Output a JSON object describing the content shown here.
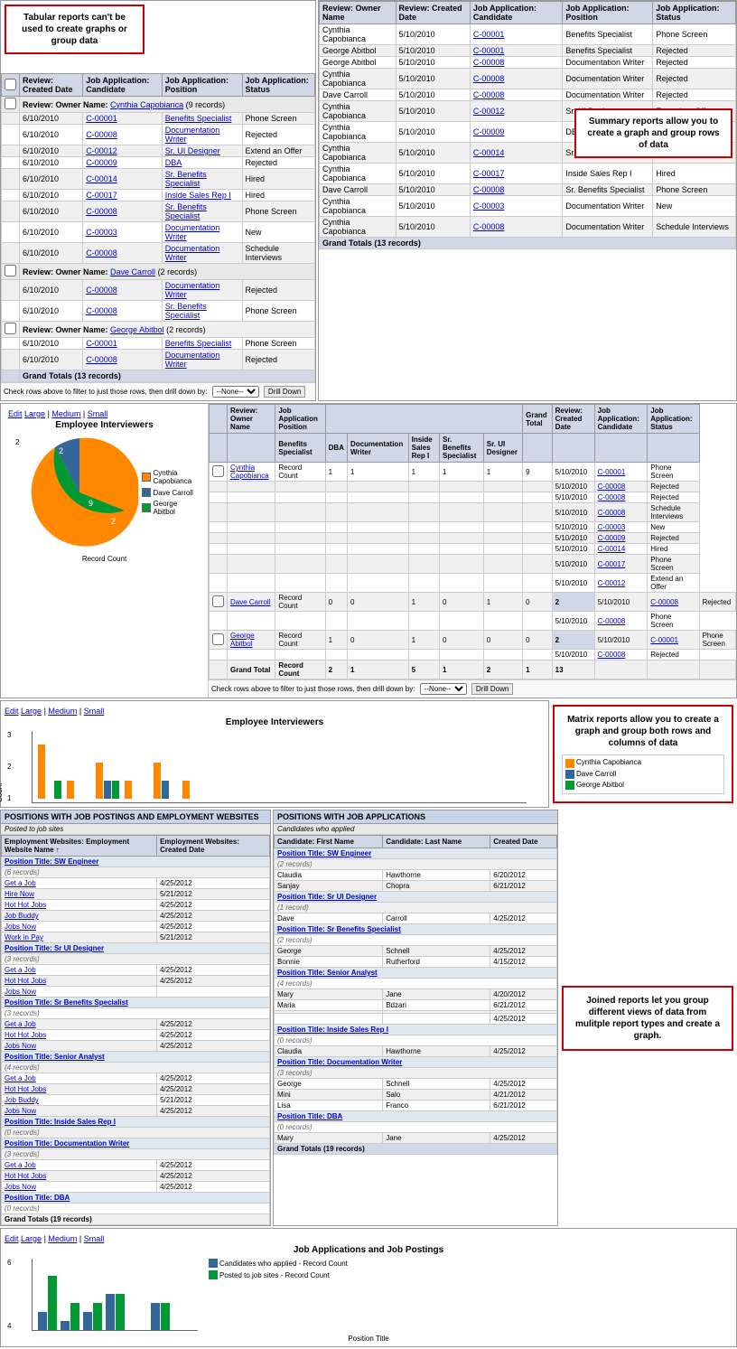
{
  "callouts": {
    "tabular": "Tabular reports can't be used to create graphs or group data",
    "summary": "Summary reports allow you to create a graph and group rows of data",
    "matrix": "Matrix reports allow you to create a graph and group both rows and columns of data",
    "joined": "Joined reports let you group different views of data from mulitple report types and create a graph."
  },
  "tabular_report": {
    "headers": [
      "Review: Created Date",
      "Job Application: Candidate",
      "Job Application: Position",
      "Job Application: Status"
    ],
    "group_label": "Review: Owner Name",
    "groups": [
      {
        "name": "Cynthia Capobianca",
        "count": "9 records",
        "rows": [
          [
            "6/10/2010",
            "C-00001",
            "Benefits Specialist",
            "Phone Screen"
          ],
          [
            "6/10/2010",
            "C-00008",
            "Documentation Writer",
            "Rejected"
          ],
          [
            "6/10/2010",
            "C-00012",
            "Sr. UI Designer",
            "Extend an Offer"
          ],
          [
            "6/10/2010",
            "C-00009",
            "DBA",
            "Rejected"
          ],
          [
            "6/10/2010",
            "C-00014",
            "Sr. Benefits Specialist",
            "Hired"
          ],
          [
            "6/10/2010",
            "C-00017",
            "Inside Sales Rep I",
            "Hired"
          ],
          [
            "6/10/2010",
            "C-00008",
            "Sr. Benefits Specialist",
            "Phone Screen"
          ],
          [
            "6/10/2010",
            "C-00003",
            "Documentation Writer",
            "New"
          ],
          [
            "6/10/2010",
            "C-00008",
            "Documentation Writer",
            "Schedule Interviews"
          ]
        ]
      },
      {
        "name": "Dave Carroll",
        "count": "2 records",
        "rows": [
          [
            "6/10/2010",
            "C-00008",
            "Documentation Writer",
            "Rejected"
          ],
          [
            "6/10/2010",
            "C-00008",
            "Sr. Benefits Specialist",
            "Phone Screen"
          ]
        ]
      },
      {
        "name": "George Abitbol",
        "count": "2 records",
        "rows": [
          [
            "6/10/2010",
            "C-00001",
            "Benefits Specialist",
            "Phone Screen"
          ],
          [
            "6/10/2010",
            "C-00008",
            "Documentation Writer",
            "Rejected"
          ]
        ]
      }
    ],
    "grand_total": "Grand Totals (13 records)"
  },
  "summary_report": {
    "headers": [
      "Review: Owner Name",
      "Review: Created Date",
      "Job Application: Candidate",
      "Job Application: Position",
      "Job Application: Status"
    ],
    "rows": [
      [
        "Cynthia Capobianca",
        "5/10/2010",
        "C-00001",
        "Benefits Specialist",
        "Phone Screen"
      ],
      [
        "George Abitbol",
        "5/10/2010",
        "C-00001",
        "Benefits Specialist",
        "Rejected"
      ],
      [
        "George Abitbol",
        "5/10/2010",
        "C-00008",
        "Documentation Writer",
        "Rejected"
      ],
      [
        "Cynthia Capobianca",
        "5/10/2010",
        "C-00008",
        "Documentation Writer",
        "Rejected"
      ],
      [
        "Dave Carroll",
        "5/10/2010",
        "C-00008",
        "Documentation Writer",
        "Rejected"
      ],
      [
        "Cynthia Capobianca",
        "5/10/2010",
        "C-00012",
        "Sr. UI Designer",
        "Extend an Offer"
      ],
      [
        "Cynthia Capobianca",
        "5/10/2010",
        "C-00009",
        "DBA",
        "Rejected"
      ],
      [
        "Cynthia Capobianca",
        "5/10/2010",
        "C-00014",
        "Sr. Benefits Specialist",
        "Hired"
      ],
      [
        "Cynthia Capobianca",
        "5/10/2010",
        "C-00017",
        "Inside Sales Rep I",
        "Hired"
      ],
      [
        "Dave Carroll",
        "5/10/2010",
        "C-00008",
        "Sr. Benefits Specialist",
        "Phone Screen"
      ],
      [
        "Cynthia Capobianca",
        "5/10/2010",
        "C-00003",
        "Documentation Writer",
        "New"
      ],
      [
        "Cynthia Capobianca",
        "5/10/2010",
        "C-00008",
        "Documentation Writer",
        "Schedule Interviews"
      ],
      [
        "Cynthia Capobianca",
        "5/10/2010",
        "C-00008",
        "Documentation Writer",
        "Schedule Interviews"
      ]
    ],
    "grand_total": "Grand Totals (13 records)"
  },
  "drill_controls": {
    "label": "Check rows above to filter to just those rows, then drill down by:",
    "placeholder": "--None--",
    "button": "Drill Down"
  },
  "pie_chart": {
    "title": "Employee Interviewers",
    "y_label": "Record Count",
    "legend": [
      {
        "label": "Cynthia Capobianca",
        "color": "#ff8800"
      },
      {
        "label": "Dave Carroll",
        "color": "#336699"
      },
      {
        "label": "George Abitbol",
        "color": "#ff6600"
      }
    ],
    "values": [
      {
        "name": "Cynthia",
        "value": 9,
        "color": "#ff8800"
      },
      {
        "name": "Dave",
        "value": 2,
        "color": "#336699"
      },
      {
        "name": "George",
        "value": 2,
        "color": "#009933"
      }
    ],
    "y_ticks": [
      "2",
      ""
    ],
    "x_label": "Record Count"
  },
  "matrix_report": {
    "title": "Employee Interviewers",
    "bar_colors": {
      "cynthia": "#ff8800",
      "dave": "#336699",
      "george": "#009933"
    },
    "y_ticks": [
      "3",
      "2",
      "1"
    ],
    "y_label": "Record Count",
    "legend": [
      {
        "label": "Cynthia Capobianca",
        "color": "#ff8800"
      },
      {
        "label": "Dave Carroll",
        "color": "#336699"
      },
      {
        "label": "George Abitbol",
        "color": "#009933"
      }
    ]
  },
  "joined_left": {
    "title": "POSITIONS WITH JOB POSTINGS AND EMPLOYMENT WEBSITES",
    "subtitle": "Posted to job sites",
    "headers": [
      "Employment Websites: Employment Website Name",
      "Employment Websites: Created Date"
    ],
    "positions": [
      {
        "title": "SW Engineer",
        "count": "6 records",
        "rows": [
          [
            "Get a Job",
            "4/25/2012"
          ],
          [
            "Hire Now",
            "5/21/2012"
          ],
          [
            "Hot Hot Jobs",
            "4/25/2012"
          ],
          [
            "Job Buddy",
            "4/25/2012"
          ],
          [
            "Jobs Now",
            "4/25/2012"
          ],
          [
            "Work in Pay",
            "5/21/2012"
          ]
        ]
      },
      {
        "title": "Sr UI Designer",
        "count": "3 records",
        "rows": [
          [
            "Get a Job",
            "4/25/2012"
          ],
          [
            "Hot Hot Jobs",
            "4/25/2012"
          ],
          [
            "Jobs Now",
            ""
          ]
        ]
      },
      {
        "title": "Sr Benefits Specialist",
        "count": "3 records",
        "rows": [
          [
            "Get a Job",
            "4/25/2012"
          ],
          [
            "Hot Hot Jobs",
            "4/25/2012"
          ],
          [
            "Jobs Now",
            "4/25/2012"
          ]
        ]
      },
      {
        "title": "Senior Analyst",
        "count": "4 records",
        "rows": [
          [
            "Get a Job",
            "4/25/2012"
          ],
          [
            "Hot Hot Jobs",
            "4/25/2012"
          ],
          [
            "Job Buddy",
            "5/21/2012"
          ],
          [
            "Jobs Now",
            "4/25/2012"
          ]
        ]
      },
      {
        "title": "Inside Sales Rep I",
        "count": "0 records",
        "rows": []
      },
      {
        "title": "Documentation Writer",
        "count": "3 records",
        "rows": [
          [
            "Get a Job",
            "4/25/2012"
          ],
          [
            "Hot Hot Jobs",
            "4/25/2012"
          ],
          [
            "Jobs Now",
            "4/25/2012"
          ]
        ]
      },
      {
        "title": "DBA",
        "count": "0 records",
        "rows": []
      }
    ],
    "grand_total": "Grand Totals (19 records)"
  },
  "joined_right": {
    "title": "POSITIONS WITH JOB APPLICATIONS",
    "subtitle": "Candidates who applied",
    "headers": [
      "Candidate: First Name",
      "Candidate: Last Name",
      "Created Date"
    ],
    "positions": [
      {
        "title": "SW Engineer",
        "count": "2 records",
        "rows": [
          [
            "Claudia",
            "Hawthorne",
            "6/20/2012"
          ],
          [
            "Sanjay",
            "Chopra",
            "6/21/2012"
          ]
        ]
      },
      {
        "title": "Sr UI Designer",
        "count": "1 record",
        "rows": [
          [
            "Dave",
            "Carroll",
            "4/25/2012"
          ]
        ]
      },
      {
        "title": "Sr Benefits Specialist",
        "count": "2 records",
        "rows": [
          [
            "George",
            "Schnell",
            "4/25/2012"
          ],
          [
            "Bonnie",
            "Rutherford",
            "4/15/2012"
          ]
        ]
      },
      {
        "title": "Senior Analyst",
        "count": "4 records",
        "rows": [
          [
            "Mary",
            "Jane",
            "4/20/2012"
          ],
          [
            "Maria",
            "Bdzari",
            "6/21/2012"
          ],
          [
            "",
            "",
            ""
          ],
          [
            "",
            "",
            "4/25/2012"
          ]
        ]
      },
      {
        "title": "Inside Sales Rep I",
        "count": "0 records",
        "rows": [
          [
            "Claudia",
            "Hawthorne",
            "4/25/2012"
          ]
        ]
      },
      {
        "title": "Documentation Writer",
        "count": "3 records",
        "rows": [
          [
            "George",
            "Schnell",
            "4/25/2012"
          ],
          [
            "Mini",
            "Salo",
            "4/21/2012"
          ],
          [
            "Lisa",
            "Franco",
            "6/21/2012"
          ]
        ]
      },
      {
        "title": "DBA",
        "count": "0 records",
        "rows": [
          [
            "Mary",
            "Jane",
            "4/25/2012"
          ]
        ]
      }
    ],
    "grand_total": "Grand Totals (19 records)"
  },
  "bottom_chart": {
    "title": "Job Applications and Job Postings",
    "edit_label": "Edit",
    "large_label": "Large",
    "medium_label": "Medium",
    "small_label": "Small",
    "y_ticks": [
      "6",
      "4"
    ],
    "legend": [
      {
        "label": "Candidates who applied - Record Count",
        "color": "#336699"
      },
      {
        "label": "Posted to job sites - Record Count",
        "color": "#009933"
      }
    ],
    "x_label": "Position Title"
  }
}
